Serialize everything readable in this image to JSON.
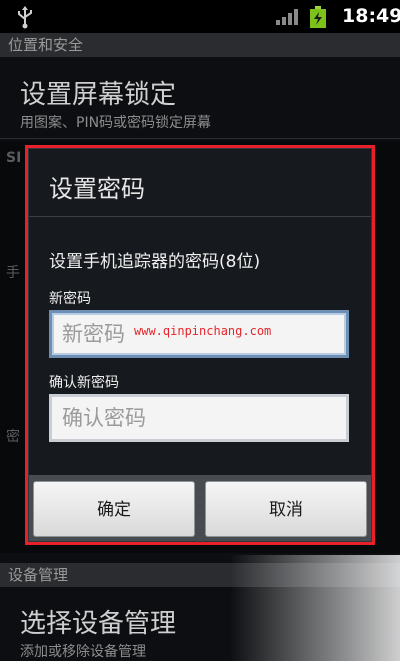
{
  "status_bar": {
    "time": "18:49"
  },
  "background": {
    "section_security": "位置和安全",
    "lock_title": "设置屏幕锁定",
    "lock_subtitle": "用图案、PIN码或密码锁定屏幕",
    "frag_sim": "SI",
    "frag_phone": "手",
    "frag_pwd": "密",
    "section_device": "设备管理",
    "device_title": "选择设备管理",
    "device_subtitle": "添加或移除设备管理"
  },
  "dialog": {
    "title": "设置密码",
    "prompt": "设置手机追踪器的密码(8位)",
    "new_label": "新密码",
    "new_placeholder": "新密码",
    "confirm_label": "确认新密码",
    "confirm_placeholder": "确认密码",
    "ok_label": "确定",
    "cancel_label": "取消"
  },
  "watermark": "www.qinpinchang.com",
  "colors": {
    "highlight": "#e8202a",
    "focus": "#6d8fb4"
  }
}
